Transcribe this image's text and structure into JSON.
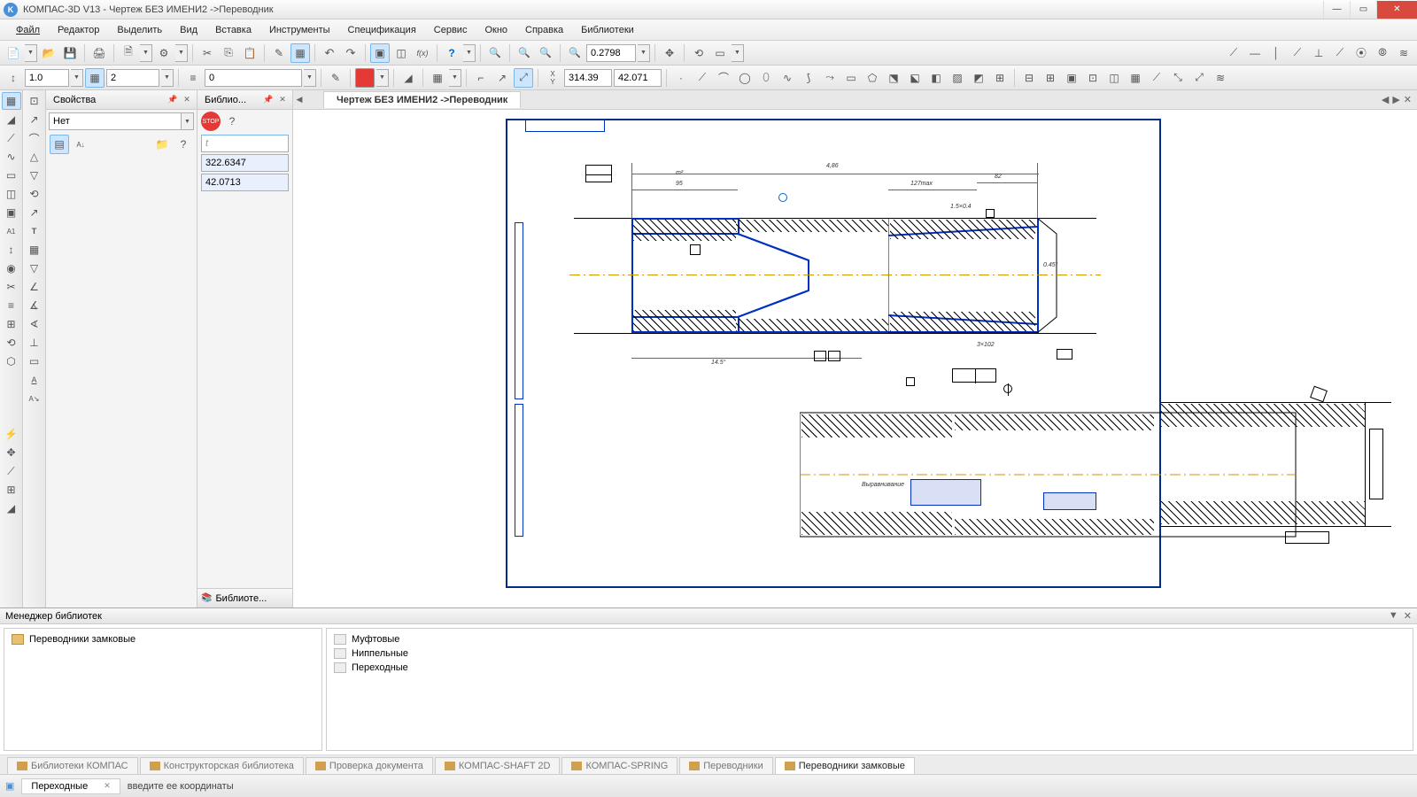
{
  "titlebar": {
    "app": "КОМПАС-3D V13",
    "doc": "Чертеж БЕЗ ИМЕНИ2 ->Переводник"
  },
  "menu": [
    "Файл",
    "Редактор",
    "Выделить",
    "Вид",
    "Вставка",
    "Инструменты",
    "Спецификация",
    "Сервис",
    "Окно",
    "Справка",
    "Библиотеки"
  ],
  "tb1": {
    "zoom": "0.2798"
  },
  "tb2": {
    "lw": "1.0",
    "layer": "2",
    "style": "0",
    "cx": "314.39",
    "cy": "42.071"
  },
  "panel_props": {
    "title": "Свойства",
    "combo": "Нет"
  },
  "panel_lib": {
    "title": "Библио...",
    "v1": "322.6347",
    "v2": "42.0713",
    "footer": "Библиоте..."
  },
  "doctab": "Чертеж БЕЗ ИМЕНИ2 ->Переводник",
  "libmgr": {
    "title": "Менеджер библиотек",
    "left": [
      "Переводники замковые"
    ],
    "right": [
      "Муфтовые",
      "Ниппельные",
      "Переходные"
    ],
    "tabs": [
      "Библиотеки КОМПАС",
      "Конструкторская библиотека",
      "Проверка документа",
      "КОМПАС-SHAFT 2D",
      "КОМПАС-SPRING",
      "Переводники",
      "Переводники замковые"
    ]
  },
  "status": {
    "tab": "Переходные",
    "msg": "введите ее координаты"
  },
  "dims": {
    "d1": "4,86",
    "d2": "m²",
    "d3": "95",
    "d4": "127max",
    "d5": "82",
    "d6": "1.5×0.4",
    "d7": "0.45°",
    "d8": "14.5°",
    "d9": "3×102",
    "d10": "Выравнивание"
  }
}
